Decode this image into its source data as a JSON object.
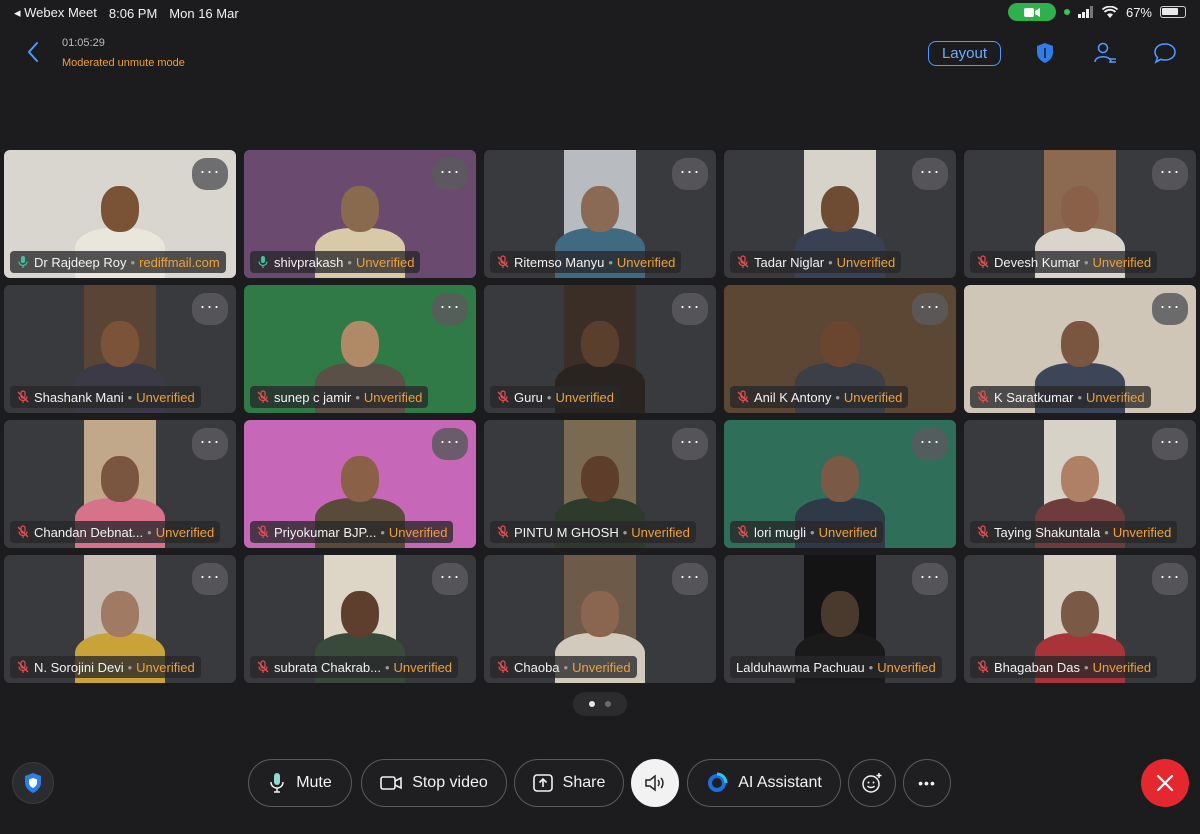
{
  "status_bar": {
    "back_app": "◂ Webex Meet",
    "time": "8:06 PM",
    "date": "Mon 16 Mar",
    "battery": "67%",
    "battery_level": 0.67
  },
  "header": {
    "duration": "01:05:29",
    "mode": "Moderated unmute mode",
    "layout_label": "Layout"
  },
  "colors": {
    "accent": "#4a9bff",
    "warning": "#f0a038",
    "active_speaker": "#26b5ac",
    "end": "#e5282f",
    "camera_pill": "#2fb04c"
  },
  "participants": [
    {
      "name": "Dr Rajdeep Roy",
      "tag": "rediffmail.com",
      "muted": false,
      "video": "full",
      "bg": "#d9d6cf",
      "skin": "#7a5236",
      "shirt": "#e9e6dc"
    },
    {
      "name": "shivprakash",
      "tag": "Unverified",
      "muted": false,
      "active": true,
      "video": "full",
      "bg": "#6a4a6e",
      "skin": "#8a6a4e",
      "shirt": "#d8c9a8"
    },
    {
      "name": "Ritemso Manyu",
      "tag": "Unverified",
      "muted": true,
      "video": "narrow",
      "bg": "#b8bcc0",
      "skin": "#8a6a55",
      "shirt": "#3f6a80"
    },
    {
      "name": "Tadar Niglar",
      "tag": "Unverified",
      "muted": true,
      "video": "narrow",
      "bg": "#d7d3cb",
      "skin": "#6e4c34",
      "shirt": "#3a4152"
    },
    {
      "name": "Devesh Kumar",
      "tag": "Unverified",
      "muted": true,
      "video": "narrow",
      "bg": "#8c6a52",
      "skin": "#8a6048",
      "shirt": "#d9d5cc"
    },
    {
      "name": "Shashank Mani",
      "tag": "Unverified",
      "muted": true,
      "video": "narrow",
      "bg": "#5a4436",
      "skin": "#7a5338",
      "shirt": "#3b3a46"
    },
    {
      "name": "sunep c jamir",
      "tag": "Unverified",
      "muted": true,
      "video": "full",
      "bg": "#2f7a46",
      "skin": "#b08a66",
      "shirt": "#5a5048"
    },
    {
      "name": "Guru",
      "tag": "Unverified",
      "muted": true,
      "video": "narrow",
      "bg": "#3a2e26",
      "skin": "#5a3f2c",
      "shirt": "#2a2420"
    },
    {
      "name": "Anil K Antony",
      "tag": "Unverified",
      "muted": true,
      "video": "full",
      "bg": "#5c4634",
      "skin": "#6a4630",
      "shirt": "#3c3f48"
    },
    {
      "name": "K Saratkumar",
      "tag": "Unverified",
      "muted": true,
      "video": "full",
      "bg": "#cfc6b8",
      "skin": "#7a5540",
      "shirt": "#3c4658"
    },
    {
      "name": "Chandan Debnat...",
      "tag": "Unverified",
      "muted": true,
      "video": "narrow",
      "bg": "#c2a88a",
      "skin": "#7a5640",
      "shirt": "#d6728a"
    },
    {
      "name": "Priyokumar BJP...",
      "tag": "Unverified",
      "muted": true,
      "video": "full",
      "bg": "#c667b8",
      "skin": "#8a6046",
      "shirt": "#5a4a3a"
    },
    {
      "name": "PINTU M GHOSH",
      "tag": "Unverified",
      "muted": true,
      "video": "narrow",
      "bg": "#7a6a52",
      "skin": "#5e3e2a",
      "shirt": "#2e3a2c"
    },
    {
      "name": "lori mugli",
      "tag": "Unverified",
      "muted": true,
      "video": "full",
      "bg": "#2f6e58",
      "skin": "#7a5a46",
      "shirt": "#2f3a48"
    },
    {
      "name": "Taying Shakuntala",
      "tag": "Unverified",
      "muted": true,
      "video": "narrow",
      "bg": "#d7d2c8",
      "skin": "#b08066",
      "shirt": "#6e3c3c"
    },
    {
      "name": "N. Sorojini Devi",
      "tag": "Unverified",
      "muted": true,
      "video": "narrow",
      "bg": "#c9bfb4",
      "skin": "#a07a62",
      "shirt": "#c9a238"
    },
    {
      "name": "subrata Chakrab...",
      "tag": "Unverified",
      "muted": true,
      "video": "narrow",
      "bg": "#ddd6c6",
      "skin": "#5e3e2c",
      "shirt": "#3a4a3a"
    },
    {
      "name": "Chaoba",
      "tag": "Unverified",
      "muted": true,
      "video": "narrow",
      "bg": "#6e5a48",
      "skin": "#8a6650",
      "shirt": "#d2cbbd"
    },
    {
      "name": "Lalduhawma Pachuau",
      "tag": "Unverified",
      "muted": false,
      "video": "narrow",
      "bg": "#141414",
      "skin": "#4a3a2e",
      "shirt": "#1a1a1a"
    },
    {
      "name": "Bhagaban Das",
      "tag": "Unverified",
      "muted": true,
      "video": "narrow",
      "bg": "#d7cfc2",
      "skin": "#7a5a46",
      "shirt": "#a8343a"
    }
  ],
  "toolbar": {
    "mute_label": "Mute",
    "stop_video_label": "Stop video",
    "share_label": "Share",
    "ai_label": "AI Assistant",
    "more_label": "•••"
  }
}
